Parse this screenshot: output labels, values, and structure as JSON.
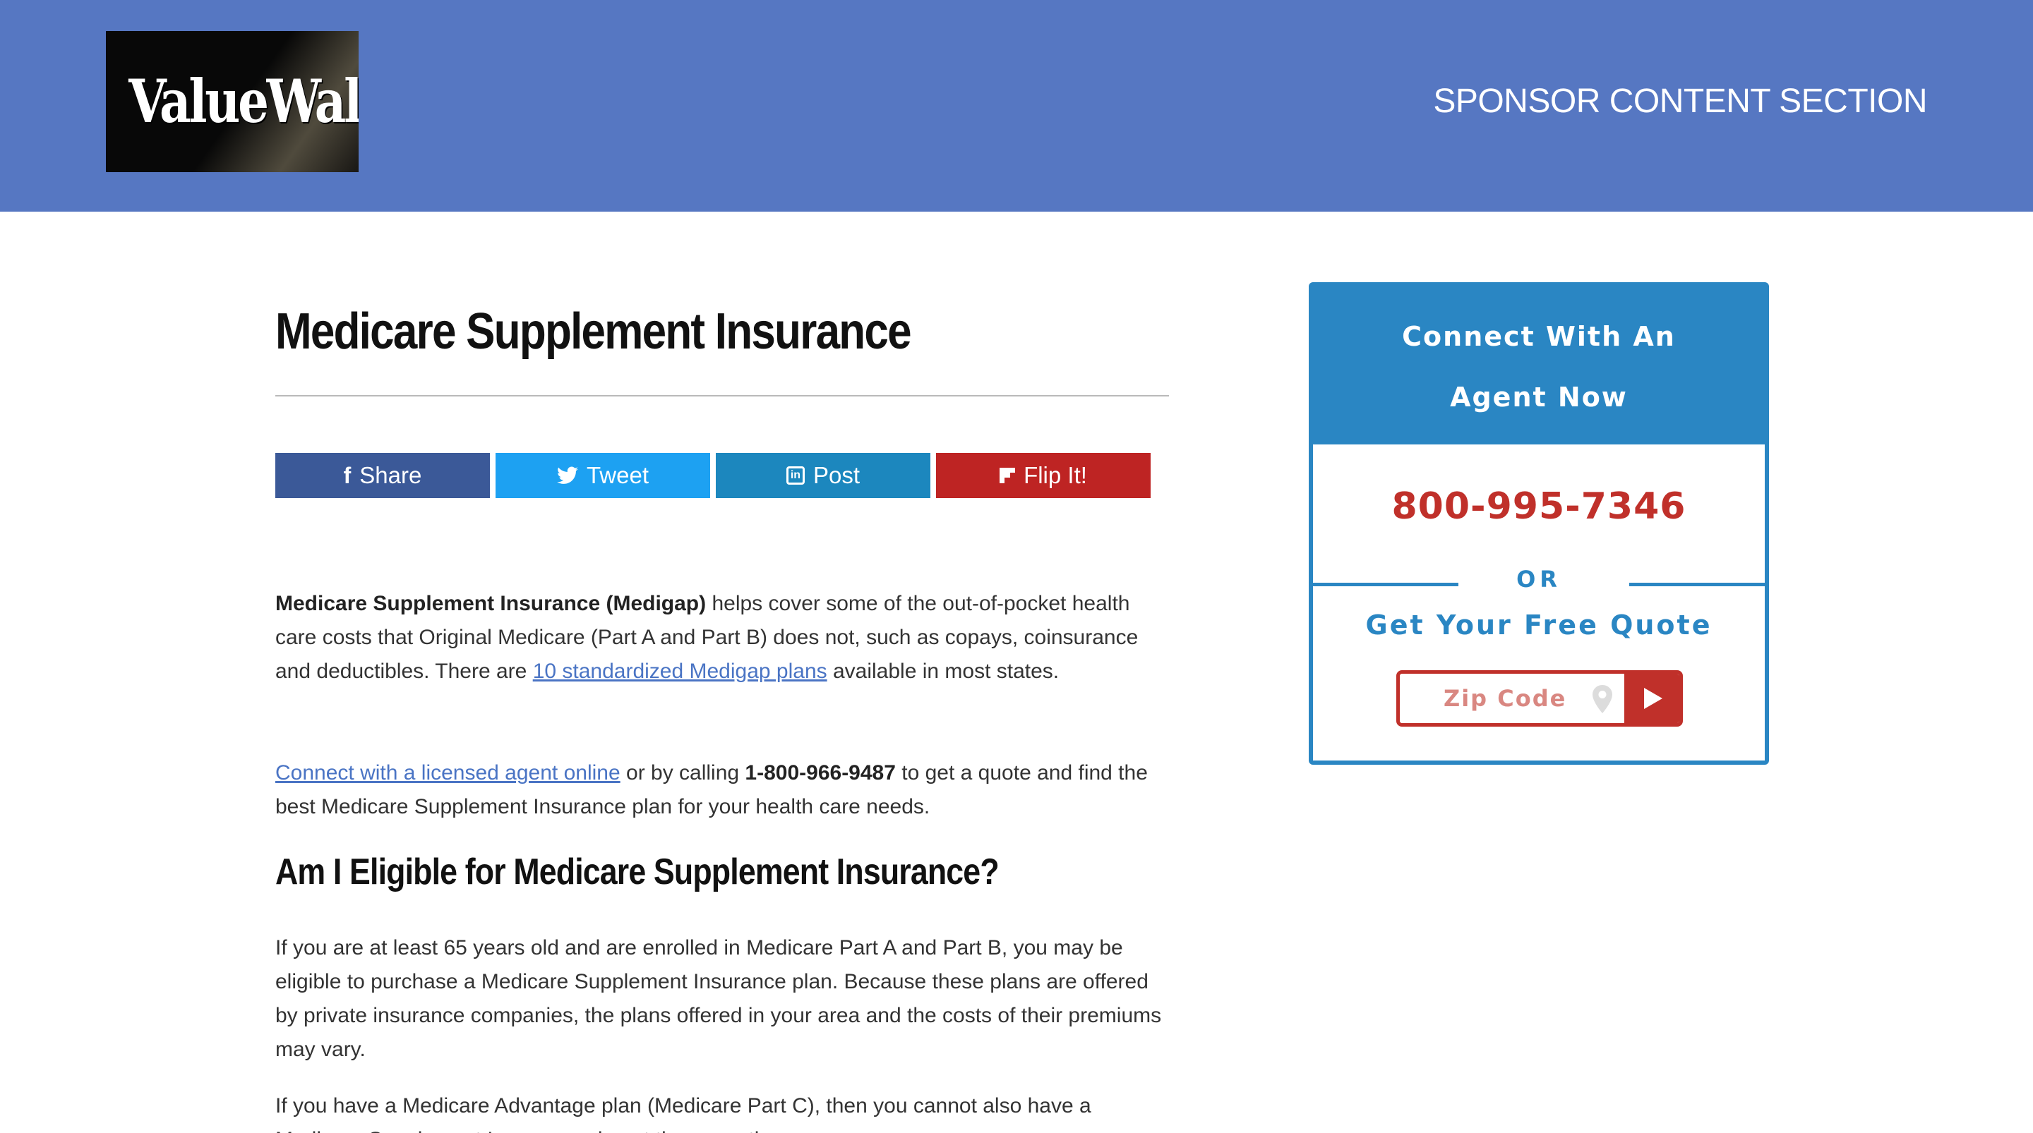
{
  "header": {
    "logo_text": "ValueWalk",
    "sponsor_label": "SPONSOR CONTENT SECTION",
    "background_color": "#5677c2"
  },
  "article": {
    "title": "Medicare Supplement Insurance",
    "share_buttons": [
      {
        "label": "Share",
        "icon": "facebook-icon",
        "color": "#3b5998"
      },
      {
        "label": "Tweet",
        "icon": "twitter-icon",
        "color": "#1da1f2"
      },
      {
        "label": "Post",
        "icon": "linkedin-icon",
        "color": "#1c87be"
      },
      {
        "label": "Flip It!",
        "icon": "flipboard-icon",
        "color": "#be2423"
      }
    ],
    "p1": {
      "bold": "Medicare Supplement Insurance (Medigap)",
      "text_a": " helps cover some of the out-of-pocket health care costs that Original Medicare (Part A and Part B) does not, such as copays, coinsurance and deductibles. There are ",
      "link": "10 standardized Medigap plans",
      "text_b": " available in most states."
    },
    "p2": {
      "link": "Connect with a licensed agent online",
      "text_a": " or by calling ",
      "phone": "1-800-966-9487",
      "text_b": " to get a quote and find the best Medicare Supplement Insurance plan for your health care needs."
    },
    "h2": "Am I Eligible for Medicare Supplement Insurance?",
    "p3": "If you are at least 65 years old and are enrolled in Medicare Part A and Part B, you may be eligible to purchase a Medicare Supplement Insurance plan. Because these plans are offered by private insurance companies, the plans offered in your area and the costs of their premiums may vary.",
    "p4": "If you have a Medicare Advantage plan (Medicare Part C), then you cannot also have a Medicare Supplement Insurance plan at the same time."
  },
  "widget": {
    "heading_line1": "Connect With An",
    "heading_line2": "Agent Now",
    "phone": "800-995-7346",
    "or_label": "OR",
    "quote_label": "Get Your Free Quote",
    "zip_placeholder": "Zip Code",
    "accent_color": "#2a86c3",
    "alert_color": "#c0302a"
  }
}
